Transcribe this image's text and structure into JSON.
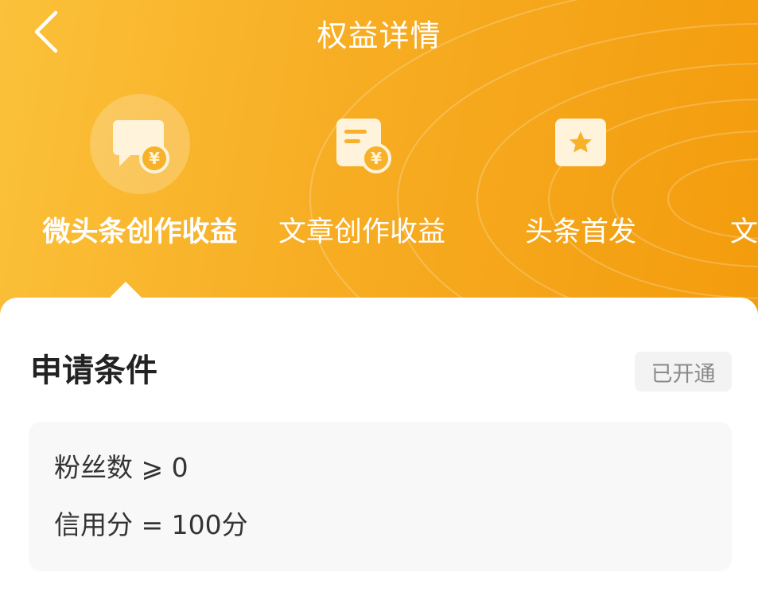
{
  "nav": {
    "title": "权益详情",
    "back_icon": "chevron-left-icon"
  },
  "tabs": [
    {
      "label": "微头条创作收益",
      "icon": "chat-bubble-yuan-icon",
      "active": true
    },
    {
      "label": "文章创作收益",
      "icon": "document-yuan-icon",
      "active": false
    },
    {
      "label": "头条首发",
      "icon": "star-card-icon",
      "active": false
    },
    {
      "label": "文",
      "icon": "",
      "active": false
    }
  ],
  "section": {
    "title": "申请条件",
    "status": "已开通"
  },
  "conditions": [
    "粉丝数 ⩾ 0",
    "信用分 = 100分"
  ],
  "colors": {
    "header_start": "#fbc13a",
    "header_end": "#f39c0d",
    "icon_fill": "#fff3dc",
    "text_primary": "#222222",
    "badge_bg": "#f3f3f3"
  }
}
